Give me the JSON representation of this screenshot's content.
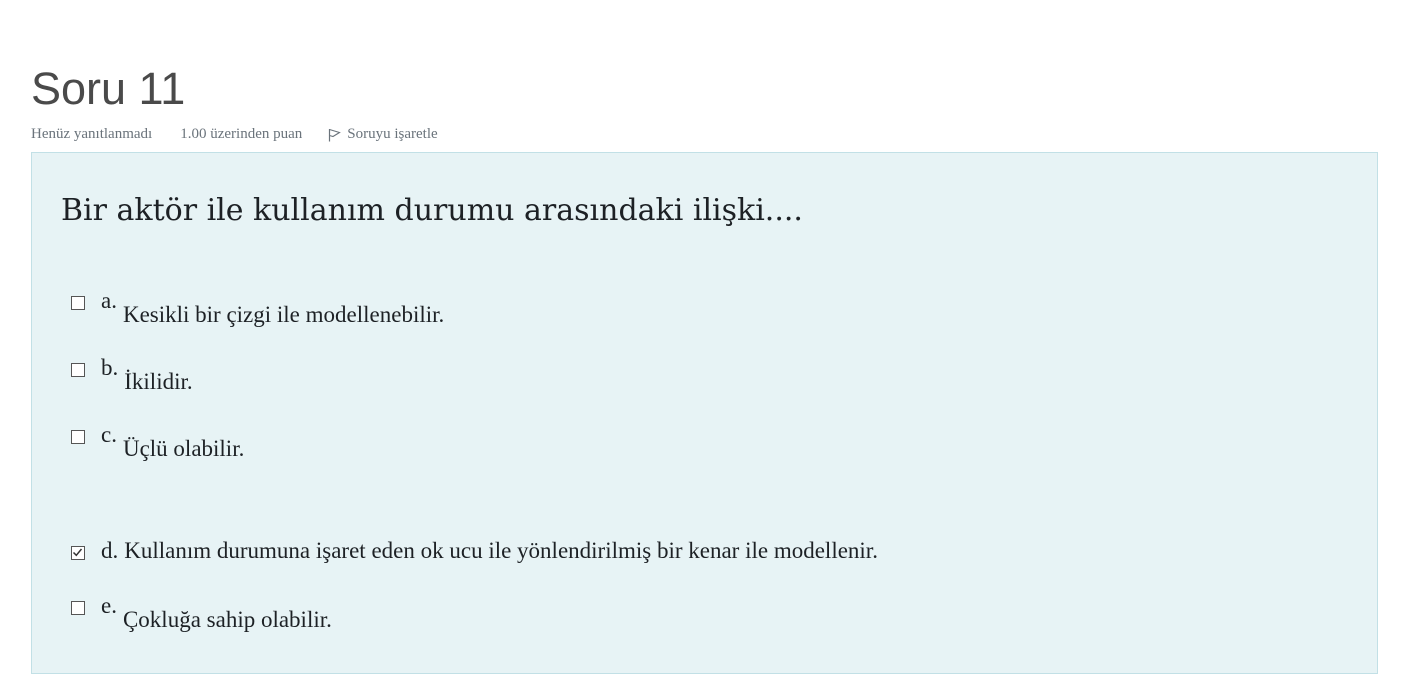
{
  "question": {
    "title": "Soru 11",
    "status": "Henüz yanıtlanmadı",
    "grade": "1.00 üzerinden puan",
    "flag_label": "Soruyu işaretle",
    "text": "Bir aktör ile kullanım durumu arasındaki ilişki....",
    "options": [
      {
        "letter": "a.",
        "text": "Kesikli bir çizgi ile modellenebilir.",
        "checked": false
      },
      {
        "letter": "b.",
        "text": "İkilidir.",
        "checked": false
      },
      {
        "letter": "c.",
        "text": "Üçlü olabilir.",
        "checked": false
      },
      {
        "letter": "d.",
        "text": "Kullanım durumuna işaret eden ok ucu ile yönlendirilmiş bir kenar ile modellenir.",
        "checked": true
      },
      {
        "letter": "e.",
        "text": "Çokluğa sahip olabilir.",
        "checked": false
      }
    ]
  },
  "colors": {
    "box_background": "#e7f3f5",
    "box_border": "#c2e0e6",
    "meta_text": "#6a737b"
  },
  "icons": {
    "flag": "flag-icon",
    "checkmark": "check-icon"
  }
}
